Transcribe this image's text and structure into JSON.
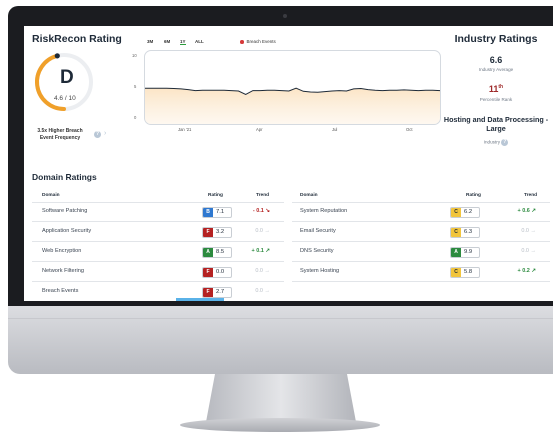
{
  "risk_recon": {
    "title": "RiskRecon Rating",
    "grade": "D",
    "score": "4.6 / 10",
    "higher_breach_text": "3.5x Higher Breach Event Frequency",
    "grade_color": "#f0a02a"
  },
  "chart": {
    "tabs": [
      {
        "label": "3M",
        "active": false
      },
      {
        "label": "6M",
        "active": false
      },
      {
        "label": "1Y",
        "active": true
      },
      {
        "label": "ALL",
        "active": false
      }
    ],
    "legend_label": "Breach Events",
    "legend_color": "#d63a3a",
    "accent_color": "#f0a02a"
  },
  "chart_data": {
    "type": "line",
    "title": "",
    "xlabel": "",
    "ylabel": "",
    "ylim": [
      0,
      10
    ],
    "yticks": [
      "10",
      "5",
      "0"
    ],
    "xtick_labels": [
      "Jan '21",
      "Apr",
      "Jul",
      "Oct"
    ],
    "series": [
      {
        "values": [
          4.9,
          4.9,
          4.9,
          4.9,
          4.85,
          4.8,
          4.7,
          4.55,
          4.6,
          4.6,
          4.6,
          4.6,
          4.55,
          4.5,
          4.0,
          4.55,
          4.55,
          4.6,
          4.6,
          4.55,
          4.5,
          4.9,
          4.45,
          4.35,
          4.3,
          4.4,
          4.5,
          4.55,
          4.5,
          4.8,
          4.85,
          4.7,
          4.6,
          4.55,
          4.6,
          4.6,
          4.65,
          4.6,
          4.55,
          4.6,
          4.6,
          4.55
        ]
      }
    ]
  },
  "industry": {
    "title": "Industry Ratings",
    "average_value": "6.6",
    "average_label": "Industry Average",
    "percentile_value": "11",
    "percentile_suffix": "th",
    "percentile_label": "Percentile Rank",
    "name": "Hosting and Data Processing - Large",
    "industry_label": "Industry",
    "percentile_color": "#9e2a2a"
  },
  "domain_ratings": {
    "title": "Domain Ratings",
    "headers": {
      "domain": "Domain",
      "rating": "Rating",
      "trend": "Trend"
    },
    "left": [
      {
        "name": "Software Patching",
        "grade": "B",
        "score": "7.1",
        "trend": "- 0.1",
        "trend_icon": "↘",
        "dir": "down"
      },
      {
        "name": "Application Security",
        "grade": "F",
        "score": "3.2",
        "trend": "0.0",
        "trend_icon": "→",
        "dir": "flat"
      },
      {
        "name": "Web Encryption",
        "grade": "A",
        "score": "8.5",
        "trend": "+ 0.1",
        "trend_icon": "↗",
        "dir": "up"
      },
      {
        "name": "Network Filtering",
        "grade": "F",
        "score": "0.0",
        "trend": "0.0",
        "trend_icon": "→",
        "dir": "flat"
      },
      {
        "name": "Breach Events",
        "grade": "F",
        "score": "2.7",
        "trend": "0.0",
        "trend_icon": "→",
        "dir": "flat"
      }
    ],
    "right": [
      {
        "name": "System Reputation",
        "grade": "C",
        "score": "6.2",
        "trend": "+ 0.6",
        "trend_icon": "↗",
        "dir": "up"
      },
      {
        "name": "Email Security",
        "grade": "C",
        "score": "6.3",
        "trend": "0.0",
        "trend_icon": "→",
        "dir": "flat"
      },
      {
        "name": "DNS Security",
        "grade": "A",
        "score": "9.9",
        "trend": "0.0",
        "trend_icon": "→",
        "dir": "flat"
      },
      {
        "name": "System Hosting",
        "grade": "C",
        "score": "5.8",
        "trend": "+ 0.2",
        "trend_icon": "↗",
        "dir": "up"
      }
    ]
  },
  "grade_colors": {
    "A": "#2c8a3f",
    "B": "#2f78d0",
    "C": "#f2c53d",
    "F": "#b52222"
  },
  "trend_colors": {
    "up": "#2c8a3f",
    "down": "#b52222",
    "flat": "#b8bec6"
  }
}
